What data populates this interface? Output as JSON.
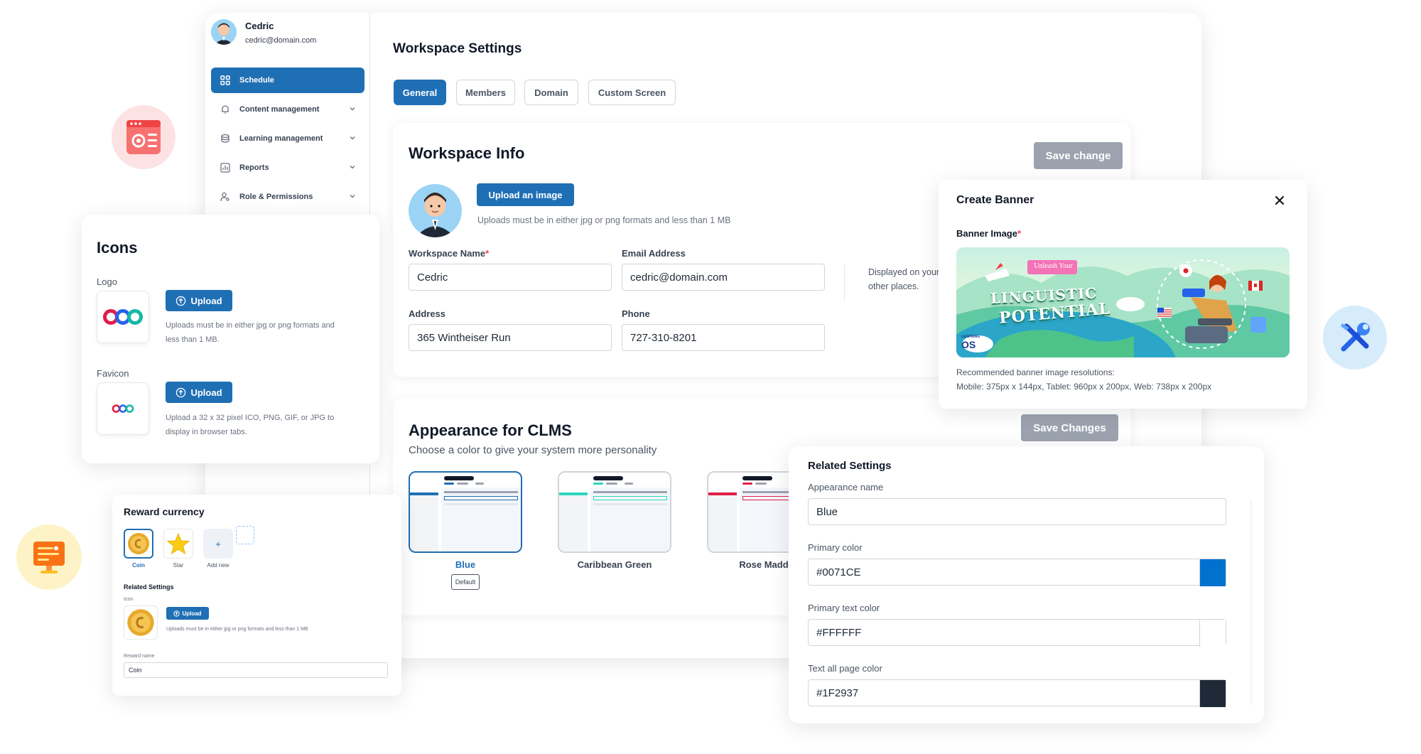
{
  "user": {
    "name": "Cedric",
    "email": "cedric@domain.com"
  },
  "sidebar": {
    "items": [
      {
        "label": "Schedule",
        "icon": "grid-icon"
      },
      {
        "label": "Content management",
        "icon": "bell-icon"
      },
      {
        "label": "Learning management",
        "icon": "database-icon"
      },
      {
        "label": "Reports",
        "icon": "chart-icon"
      },
      {
        "label": "Role & Permissions",
        "icon": "user-key-icon"
      }
    ]
  },
  "page": {
    "title": "Workspace Settings",
    "tabs": [
      "General",
      "Members",
      "Domain",
      "Custom Screen"
    ]
  },
  "workspace_info": {
    "title": "Workspace Info",
    "save_label": "Save change",
    "upload_label": "Upload an image",
    "upload_hint": "Uploads must be in either jpg or png formats and less than 1 MB",
    "name_label": "Workspace Name",
    "name_value": "Cedric",
    "email_label": "Email Address",
    "email_value": "cedric@domain.com",
    "address_label": "Address",
    "address_value": "365 Wintheiser Run",
    "phone_label": "Phone",
    "phone_value": "727-310-8201",
    "side_note_line1": "Displayed on your",
    "side_note_line2": "other places."
  },
  "appearance": {
    "title": "Appearance for CLMS",
    "subtitle": "Choose a color to give your system more personality",
    "save_label": "Save Changes",
    "themes": [
      {
        "name": "Blue",
        "color": "#1F6FB5",
        "badge": "Default"
      },
      {
        "name": "Caribbean Green",
        "color": "#2DD4BF"
      },
      {
        "name": "Rose Madd",
        "color": "#E11D48"
      }
    ]
  },
  "icons_panel": {
    "title": "Icons",
    "logo_label": "Logo",
    "favicon_label": "Favicon",
    "upload_label": "Upload",
    "logo_hint_1": "Uploads must be in either jpg or png formats and",
    "logo_hint_2": "less than 1 MB.",
    "favicon_hint_1": "Upload a 32 x 32 pixel ICO, PNG, GIF, or JPG to",
    "favicon_hint_2": "display in browser tabs."
  },
  "reward": {
    "title": "Reward currency",
    "items": [
      "Coin",
      "Star",
      "Add new"
    ],
    "add_symbol": "+",
    "related_title": "Related Settings",
    "icon_label": "Icon",
    "upload_label": "Upload",
    "upload_hint": "Uploads must be in either jpg or png formats and less than 1 MB",
    "name_label": "Reward name",
    "name_value": "Coin"
  },
  "banner": {
    "title": "Create Banner",
    "image_label": "Banner Image",
    "ribbon_text": "Unleash Your",
    "headline_1": "LINGUISTIC",
    "headline_2": "POTENTIAL",
    "brand_top": "LEARNING",
    "brand": "OS",
    "rec_title": "Recommended banner image resolutions:",
    "rec_sizes": "Mobile: 375px x 144px, Tablet: 960px x 200px, Web: 738px x 200px"
  },
  "related_settings": {
    "title": "Related Settings",
    "appearance_name_label": "Appearance name",
    "appearance_name_value": "Blue",
    "primary_color_label": "Primary color",
    "primary_color_value": "#0071CE",
    "primary_text_color_label": "Primary text color",
    "primary_text_color_value": "#FFFFFF",
    "text_all_label": "Text all page color",
    "text_all_value": "#1F2937"
  },
  "colors": {
    "accent": "#1F6FB5",
    "primary": "#0071CE",
    "primary_text": "#FFFFFF",
    "text_all": "#1F2937",
    "disabled": "#9CA3AF",
    "required": "#EF4444"
  },
  "deco_icons": [
    "settings-window-icon",
    "tools-icon",
    "presentation-icon"
  ]
}
